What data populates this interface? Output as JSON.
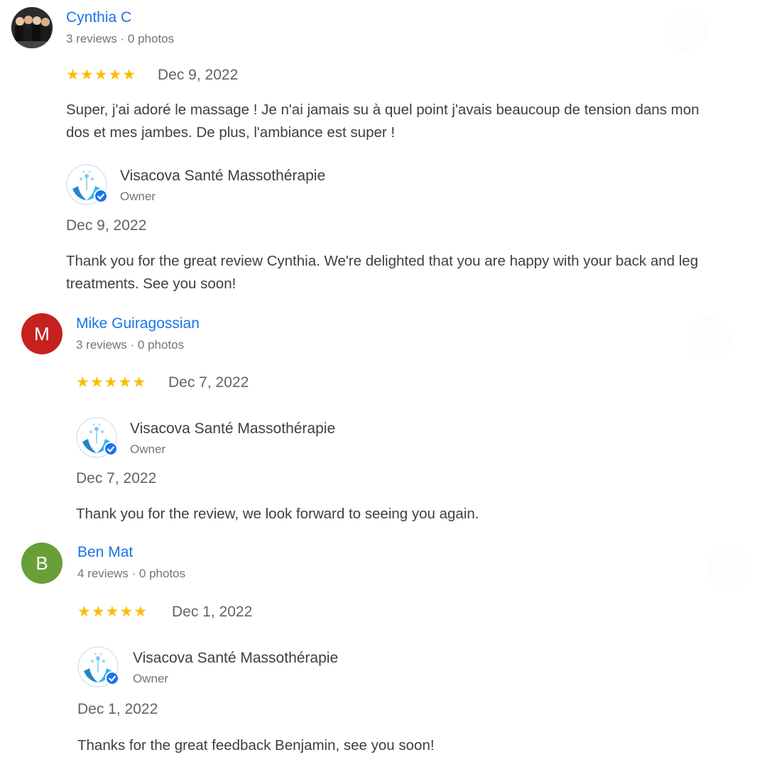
{
  "reviews": [
    {
      "reviewer": "Cynthia C",
      "meta": "3 reviews · 0 photos",
      "avatar": {
        "type": "photo",
        "color": "#2b2b2b"
      },
      "rating": 5,
      "stars_text": "★★★★★",
      "date": "Dec 9, 2022",
      "text": "Super, j'ai adoré le massage ! Je n'ai jamais su à quel point j'avais beaucoup de tension dans mon dos et mes jambes. De plus, l'ambiance est super !",
      "owner": {
        "name": "Visacova Santé Massothérapie",
        "role": "Owner",
        "date": "Dec 9, 2022",
        "text": "Thank you for the great review Cynthia. We're delighted that you are happy with your back and leg treatments. See you soon!"
      }
    },
    {
      "reviewer": "Mike Guiragossian",
      "meta": "3 reviews · 0 photos",
      "avatar": {
        "type": "letter",
        "letter": "M",
        "color": "#c5221f"
      },
      "rating": 5,
      "stars_text": "★★★★★",
      "date": "Dec 7, 2022",
      "text": "",
      "owner": {
        "name": "Visacova Santé Massothérapie",
        "role": "Owner",
        "date": "Dec 7, 2022",
        "text": "Thank you for the review, we look forward to seeing you again."
      }
    },
    {
      "reviewer": "Ben Mat",
      "meta": "4 reviews · 0 photos",
      "avatar": {
        "type": "letter",
        "letter": "B",
        "color": "#689f38"
      },
      "rating": 5,
      "stars_text": "★★★★★",
      "date": "Dec 1, 2022",
      "text": "",
      "owner": {
        "name": "Visacova Santé Massothérapie",
        "role": "Owner",
        "date": "Dec 1, 2022",
        "text": "Thanks for the great feedback Benjamin, see you soon!"
      }
    }
  ],
  "colors": {
    "link": "#1a73e8",
    "star": "#fbbc04",
    "verified": "#1a73e8",
    "logo": "#29a8e0"
  }
}
